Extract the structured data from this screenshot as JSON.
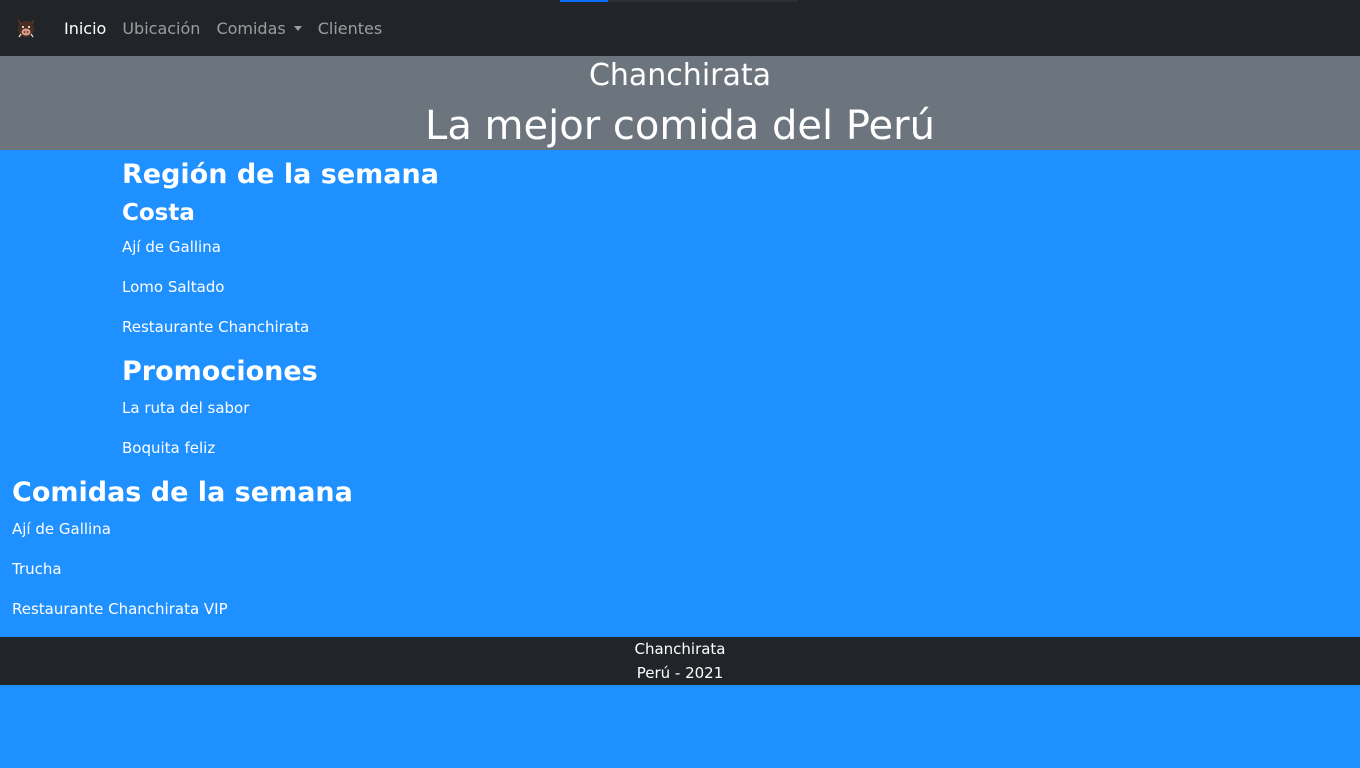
{
  "nav": {
    "brand_icon": "boar-logo-icon",
    "items": [
      {
        "label": "Inicio",
        "active": true
      },
      {
        "label": "Ubicación",
        "active": false
      },
      {
        "label": "Comidas",
        "active": false,
        "dropdown": true
      },
      {
        "label": "Clientes",
        "active": false
      }
    ]
  },
  "hero": {
    "title": "Chanchirata",
    "subtitle": "La mejor comida del Perú"
  },
  "region": {
    "heading": "Región de la semana",
    "name": "Costa",
    "items": [
      "Ají de Gallina",
      "Lomo Saltado",
      "Restaurante Chanchirata"
    ]
  },
  "promos": {
    "heading": "Promociones",
    "items": [
      "La ruta del sabor",
      "Boquita feliz"
    ]
  },
  "weekly": {
    "heading": "Comidas de la semana",
    "items": [
      "Ají de Gallina",
      "Trucha",
      "Restaurante Chanchirata VIP"
    ]
  },
  "footer": {
    "line1": "Chanchirata",
    "line2": "Perú - 2021"
  },
  "colors": {
    "page_bg": "#1e90ff",
    "navbar_bg": "#212529",
    "hero_bg": "#6c757d",
    "footer_bg": "#212529"
  }
}
